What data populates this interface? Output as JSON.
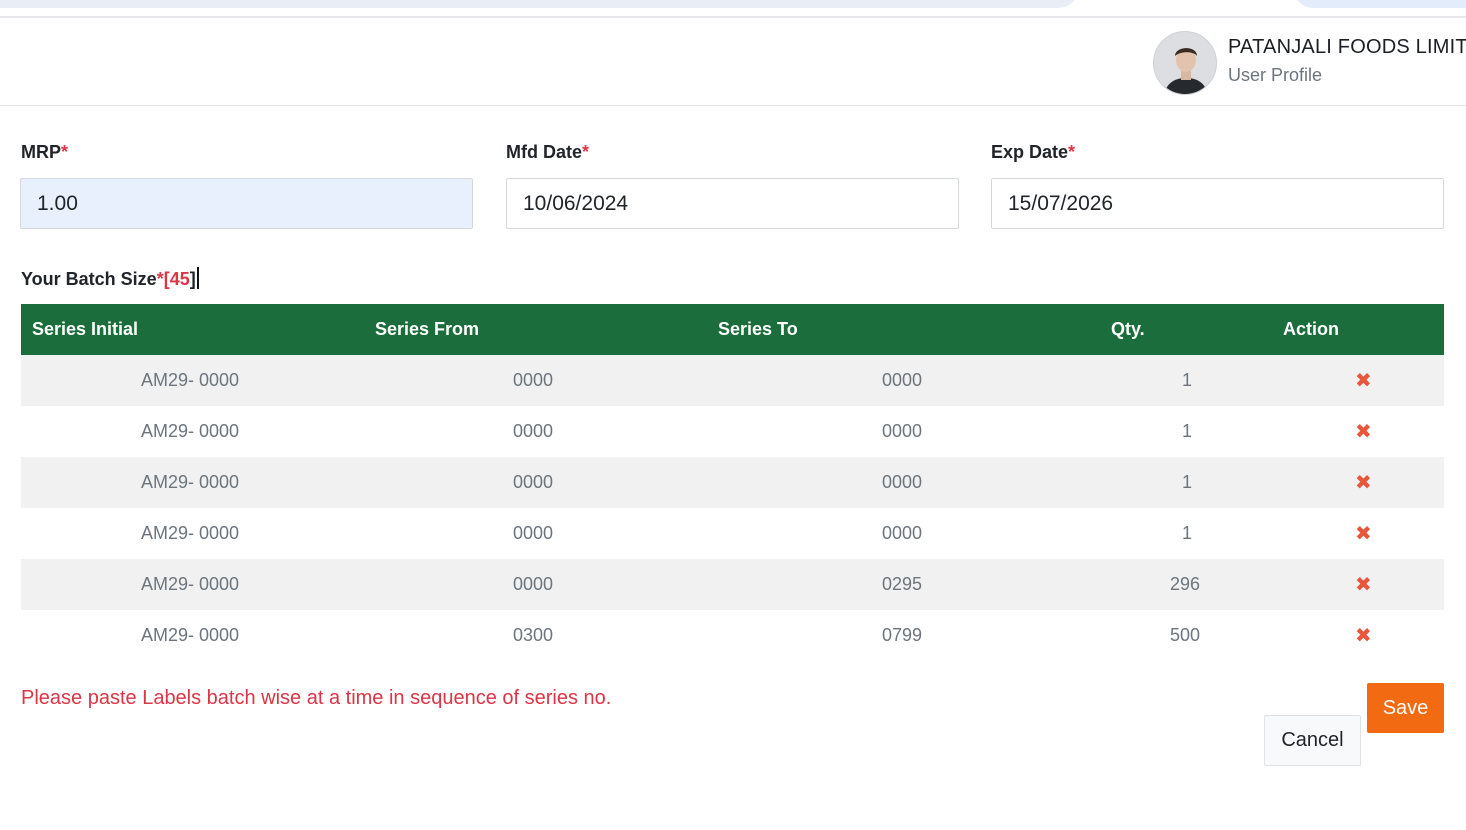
{
  "header": {
    "company": "PATANJALI FOODS LIMIT",
    "profile_label": "User Profile"
  },
  "form": {
    "mrp_label": "MRP",
    "mrp_value": "1.00",
    "mfd_label": "Mfd Date",
    "mfd_value": "10/06/2024",
    "exp_label": "Exp Date",
    "exp_value": "15/07/2026",
    "required_mark": "*",
    "batch_label": "Your Batch Size",
    "batch_open": "[",
    "batch_value": "45",
    "batch_close": "]"
  },
  "table": {
    "headers": [
      "Series Initial",
      "Series From",
      "Series To",
      "Qty.",
      "Action"
    ],
    "rows": [
      {
        "initial": "AM29- 0000",
        "from": "0000",
        "to": "0000",
        "qty": "1"
      },
      {
        "initial": "AM29- 0000",
        "from": "0000",
        "to": "0000",
        "qty": "1"
      },
      {
        "initial": "AM29- 0000",
        "from": "0000",
        "to": "0000",
        "qty": "1"
      },
      {
        "initial": "AM29- 0000",
        "from": "0000",
        "to": "0000",
        "qty": "1"
      },
      {
        "initial": "AM29- 0000",
        "from": "0000",
        "to": "0295",
        "qty": "296"
      },
      {
        "initial": "AM29- 0000",
        "from": "0300",
        "to": "0799",
        "qty": "500"
      }
    ],
    "delete_icon": "close-icon"
  },
  "note": "Please paste Labels batch wise at a time in sequence of series no.",
  "buttons": {
    "save": "Save",
    "cancel": "Cancel"
  },
  "colors": {
    "header_green": "#1b6e3b",
    "accent_orange": "#f26a12",
    "required_red": "#dc3545",
    "delete_red": "#e8573a"
  }
}
